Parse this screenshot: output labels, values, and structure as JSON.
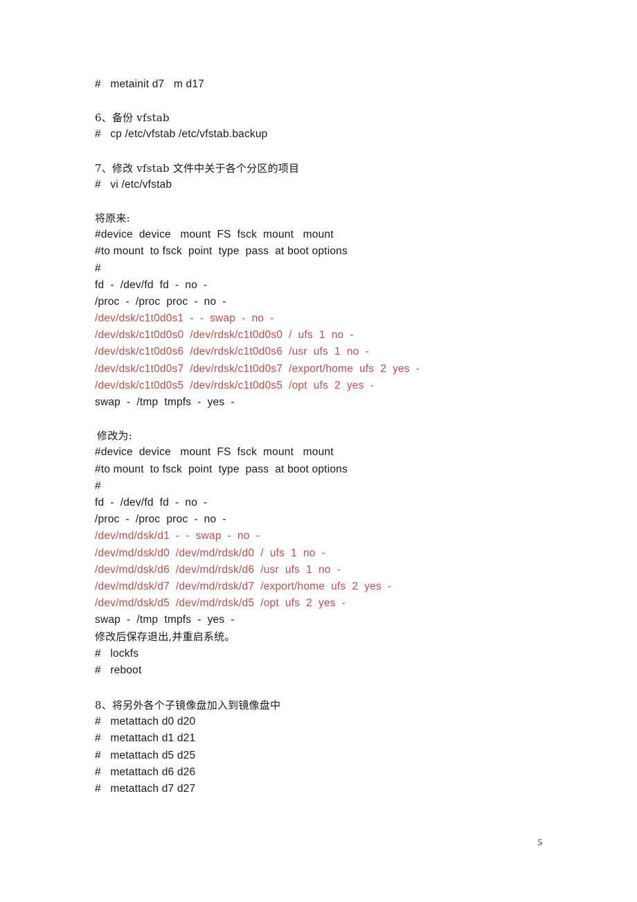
{
  "document": {
    "page_number": "5",
    "accent_red": "#c0504d",
    "text_color": "#1a1a1a",
    "background": "#ffffff"
  },
  "content": {
    "line_metainit_d7": "#   metainit d7   m d17",
    "section6_heading": "6、备份 vfstab",
    "line_cp_vfstab": "#   cp /etc/vfstab /etc/vfstab.backup",
    "section7_heading": "7、修改 vfstab 文件中关于各个分区的项目",
    "line_vi_vfstab": "#   vi /etc/vfstab",
    "before_label": "将原来:",
    "before_block": [
      {
        "text": "#device  device   mount  FS  fsck  mount   mount",
        "color": "black"
      },
      {
        "text": "#to mount  to fsck  point  type  pass  at boot options",
        "color": "black"
      },
      {
        "text": "#",
        "color": "black"
      },
      {
        "text": "fd  -  /dev/fd  fd  -  no  -",
        "color": "black"
      },
      {
        "text": "/proc  -  /proc  proc  -  no  -",
        "color": "black"
      },
      {
        "text": "/dev/dsk/c1t0d0s1  -  -  swap  -  no  -",
        "color": "red"
      },
      {
        "text": "/dev/dsk/c1t0d0s0  /dev/rdsk/c1t0d0s0  /  ufs  1  no  -",
        "color": "red"
      },
      {
        "text": "/dev/dsk/c1t0d0s6  /dev/rdsk/c1t0d0s6  /usr  ufs  1  no  -",
        "color": "red"
      },
      {
        "text": "/dev/dsk/c1t0d0s7  /dev/rdsk/c1t0d0s7  /export/home  ufs  2  yes  -",
        "color": "red"
      },
      {
        "text": "/dev/dsk/c1t0d0s5  /dev/rdsk/c1t0d0s5  /opt  ufs  2  yes  -",
        "color": "red"
      },
      {
        "text": "swap  -  /tmp  tmpfs  -  yes  -",
        "color": "black"
      }
    ],
    "after_label": "修改为:",
    "after_block": [
      {
        "text": "#device  device   mount  FS  fsck  mount   mount",
        "color": "black"
      },
      {
        "text": "#to mount  to fsck  point  type  pass  at boot options",
        "color": "black"
      },
      {
        "text": "#",
        "color": "black"
      },
      {
        "text": "fd  -  /dev/fd  fd  -  no  -",
        "color": "black"
      },
      {
        "text": "/proc  -  /proc  proc  -  no  -",
        "color": "black"
      },
      {
        "text": "/dev/md/dsk/d1  -  -  swap  -  no  -",
        "color": "red"
      },
      {
        "text": "/dev/md/dsk/d0  /dev/md/rdsk/d0  /  ufs  1  no  -",
        "color": "red"
      },
      {
        "text": "/dev/md/dsk/d6  /dev/md/rdsk/d6  /usr  ufs  1  no  -",
        "color": "red"
      },
      {
        "text": "/dev/md/dsk/d7  /dev/md/rdsk/d7  /export/home  ufs  2  yes  -",
        "color": "red"
      },
      {
        "text": "/dev/md/dsk/d5  /dev/md/rdsk/d5  /opt  ufs  2  yes  -",
        "color": "red"
      },
      {
        "text": "swap  -  /tmp  tmpfs  -  yes  -",
        "color": "black"
      }
    ],
    "save_exit_note": "修改后保存退出,并重启系统。",
    "line_lockfs": "#   lockfs",
    "line_reboot": "#   reboot",
    "section8_heading": "8、将另外各个子镜像盘加入到镜像盘中",
    "metattach_commands": [
      "#   metattach d0 d20",
      "#   metattach d1 d21",
      "#   metattach d5 d25",
      "#   metattach d6 d26",
      "#   metattach d7 d27"
    ]
  }
}
